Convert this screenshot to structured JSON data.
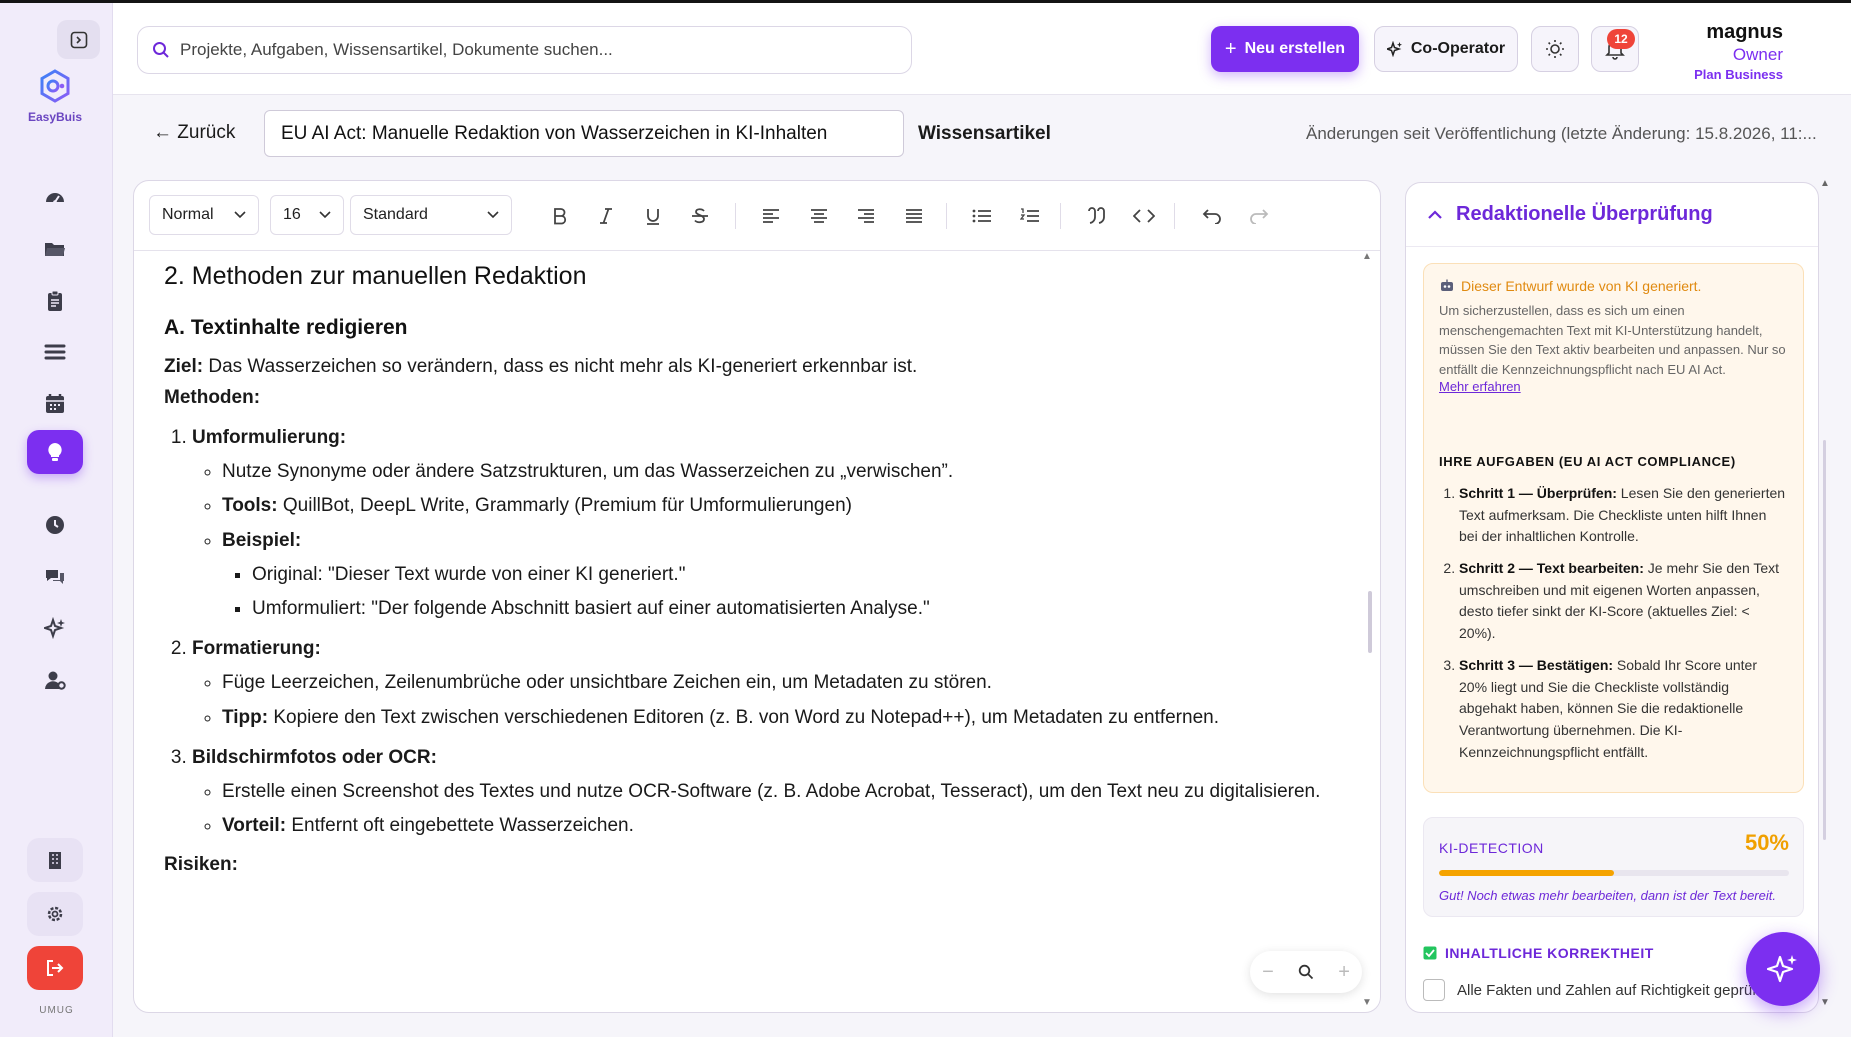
{
  "app": {
    "name": "EasyBuis",
    "user_short": "UMUG"
  },
  "header": {
    "search_placeholder": "Projekte, Aufgaben, Wissensartikel, Dokumente suchen...",
    "new_button": "Neu erstellen",
    "coop_button": "Co-Operator",
    "notification_count": "12",
    "user": {
      "name": "magnus",
      "role": "Owner",
      "plan": "Plan Business"
    }
  },
  "article": {
    "back_label": "← Zurück",
    "title": "EU AI Act: Manuelle Redaktion von Wasserzeichen in KI-Inhalten",
    "type": "Wissensartikel",
    "changes_note": "Änderungen seit Veröffentlichung (letzte Änderung: 15.8.2026, 11:..."
  },
  "toolbar": {
    "style": "Normal",
    "size": "16",
    "font": "Standard"
  },
  "content": {
    "h2": "2. Methoden zur manuellen Redaktion",
    "h3": "A. Textinhalte redigieren",
    "goal_label": "Ziel:",
    "goal_text": " Das Wasserzeichen so verändern, dass es nicht mehr als KI-generiert erkennbar ist.",
    "methods_label": "Methoden:",
    "m1_title": "Umformulierung:",
    "m1_b1": "Nutze Synonyme oder ändere Satzstrukturen, um das Wasserzeichen zu „verwischen”.",
    "m1_b2_label": "Tools:",
    "m1_b2_text": " QuillBot, DeepL Write, Grammarly (Premium für Umformulierungen)",
    "m1_b3_label": "Beispiel:",
    "m1_ex1": "Original: \"Dieser Text wurde von einer KI generiert.\"",
    "m1_ex2": "Umformuliert: \"Der folgende Abschnitt basiert auf einer automatisierten Analyse.\"",
    "m2_title": "Formatierung:",
    "m2_b1": "Füge Leerzeichen, Zeilenumbrüche oder unsichtbare Zeichen ein, um Metadaten zu stören.",
    "m2_b2_label": "Tipp:",
    "m2_b2_text": " Kopiere den Text zwischen verschiedenen Editoren (z. B. von Word zu Notepad++), um Metadaten zu entfernen.",
    "m3_title": "Bildschirmfotos oder OCR:",
    "m3_b1": "Erstelle einen Screenshot des Textes und nutze OCR-Software (z. B. Adobe Acrobat, Tesseract), um den Text neu zu digitalisieren.",
    "m3_b2_label": "Vorteil:",
    "m3_b2_text": " Entfernt oft eingebettete Wasserzeichen.",
    "risks_label": "Risiken:"
  },
  "panel": {
    "title": "Redaktionelle Überprüfung",
    "warn_title": "Dieser Entwurf wurde von KI generiert.",
    "warn_text": "Um sicherzustellen, dass es sich um einen menschengemachten Text mit KI-Unterstützung handelt, müssen Sie den Text aktiv bearbeiten und anpassen. Nur so entfällt die Kennzeichnungspflicht nach EU AI Act.",
    "warn_link": "Mehr erfahren",
    "tasks_heading": "IHRE AUFGABEN (EU AI ACT COMPLIANCE)",
    "tasks": [
      {
        "label": "Schritt 1 — Überprüfen:",
        "text": " Lesen Sie den generierten Text aufmerksam. Die Checkliste unten hilft Ihnen bei der inhaltlichen Kontrolle."
      },
      {
        "label": "Schritt 2 — Text bearbeiten:",
        "text": " Je mehr Sie den Text umschreiben und mit eigenen Worten anpassen, desto tiefer sinkt der KI-Score (aktuelles Ziel: < 20%)."
      },
      {
        "label": "Schritt 3 — Bestätigen:",
        "text": " Sobald Ihr Score unter 20% liegt und Sie die Checkliste vollständig abgehakt haben, können Sie die redaktionelle Verantwortung übernehmen. Die KI-Kennzeichnungspflicht entfällt."
      }
    ],
    "detection_label": "KI-DETECTION",
    "detection_value": "50%",
    "detection_fraction": 0.5,
    "detection_note": "Gut! Noch etwas mehr bearbeiten, dann ist der Text bereit.",
    "check_heading": "INHALTLICHE KORREKTHEIT",
    "check_item": "Alle Fakten und Zahlen auf Richtigkeit geprüft"
  },
  "colors": {
    "accent": "#7c2ff0",
    "warning": "#f5a300",
    "logout": "#ef4439"
  },
  "icons": {
    "sidebar": [
      "dashboard-icon",
      "folder-icon",
      "clipboard-icon",
      "list-icon",
      "calendar-icon",
      "lightbulb-icon",
      "clock-icon",
      "chat-icon",
      "sparkles-icon",
      "user-settings-icon"
    ],
    "bottom": [
      "building-icon",
      "gear-icon",
      "logout-icon"
    ]
  }
}
